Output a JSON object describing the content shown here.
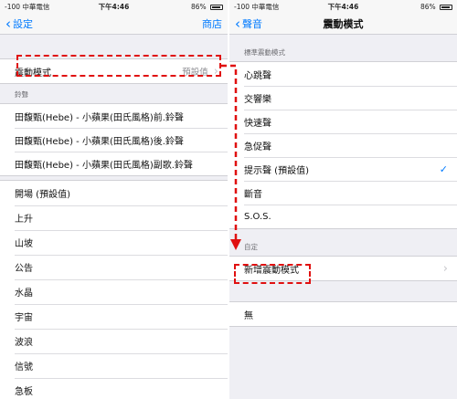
{
  "colors": {
    "accent": "#007aff",
    "annotation": "#e01010"
  },
  "left": {
    "status": {
      "carrier": "-100 中華電信",
      "time": "下午4:46",
      "battery": "86%",
      "battery_level": 0.86
    },
    "nav": {
      "back": "設定",
      "right": "商店"
    },
    "vibration_row": {
      "label": "震動模式",
      "value": "預設值"
    },
    "ringtone_header": "鈴聲",
    "ringtones": [
      "田馥甄(Hebe) - 小蘋果(田氏風格)前.鈴聲",
      "田馥甄(Hebe) - 小蘋果(田氏風格)後.鈴聲",
      "田馥甄(Hebe) - 小蘋果(田氏風格)副歌.鈴聲"
    ],
    "tones": [
      "開場 (預設值)",
      "上升",
      "山坡",
      "公告",
      "水晶",
      "宇宙",
      "波浪",
      "信號",
      "急板"
    ]
  },
  "right": {
    "status": {
      "carrier": "-100 中華電信",
      "time": "下午4:46",
      "battery": "86%",
      "battery_level": 0.86
    },
    "nav": {
      "back": "聲音",
      "title": "震動模式"
    },
    "standard_header": "標準震動模式",
    "standard_items": [
      "心跳聲",
      "交響樂",
      "快速聲",
      "急促聲",
      "提示聲 (預設值)",
      "斷音",
      "S.O.S."
    ],
    "selected_index": 4,
    "custom_header": "自定",
    "custom_create": "新增震動模式",
    "none_label": "無"
  }
}
